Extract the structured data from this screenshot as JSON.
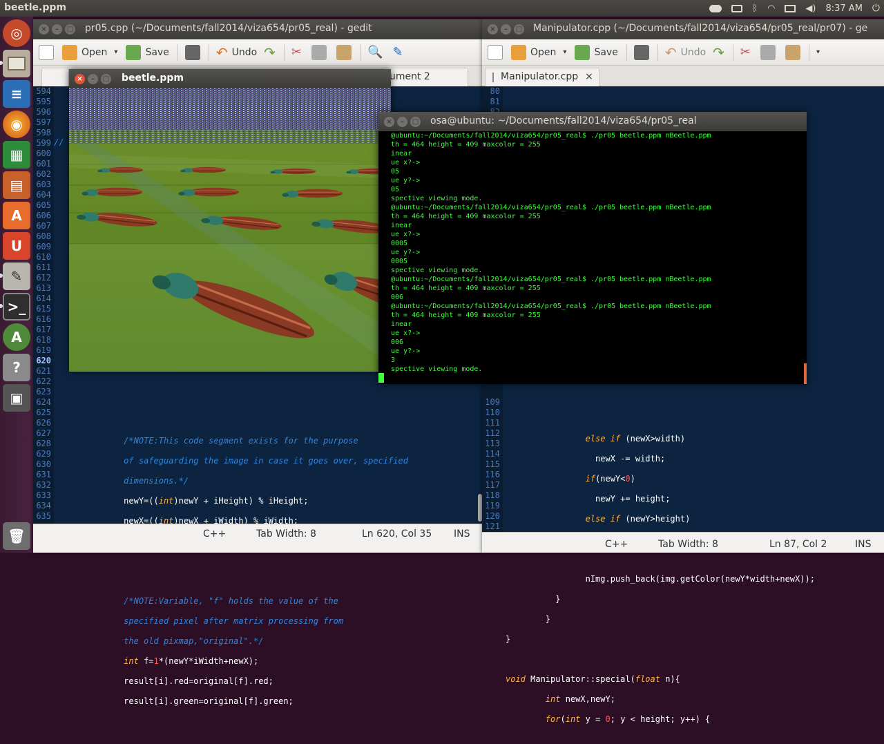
{
  "top_panel": {
    "active_title": "beetle.ppm",
    "time": "8:37 AM",
    "icons": [
      "cloud-icon",
      "keyboard-icon",
      "bluetooth-icon",
      "wifi-icon",
      "mail-icon",
      "volume-icon",
      "power-icon"
    ]
  },
  "launcher": {
    "items": [
      "ubuntu-dash-icon",
      "files-icon",
      "writer-icon",
      "firefox-icon",
      "calc-icon",
      "impress-icon",
      "software-center-icon",
      "ubuntu-one-icon",
      "text-editor-icon",
      "terminal-icon",
      "update-manager-icon",
      "help-icon",
      "save-icon",
      "trash-icon"
    ]
  },
  "gedit_left": {
    "title": "pr05.cpp (~/Documents/fall2014/viza654/pr05_real) - gedit",
    "toolbar": {
      "open": "Open",
      "save": "Save",
      "undo": "Undo"
    },
    "tab_partial": "ument 2",
    "line_numbers": [
      "594",
      "595",
      "596",
      "597",
      "598",
      "599",
      "600",
      "601",
      "602",
      "603",
      "604",
      "605",
      "606",
      "607",
      "608",
      "609",
      "610",
      "611",
      "612",
      "613",
      "614",
      "615",
      "616",
      "617",
      "618",
      "619",
      "620",
      "621",
      "622",
      "623",
      "624",
      "625",
      "626",
      "627",
      "628",
      "629",
      "630",
      "631",
      "632",
      "633",
      "634",
      "635"
    ],
    "status": {
      "language": "C++",
      "tab_width": "Tab Width:  8",
      "position": "Ln 620, Col 35",
      "mode": "INS"
    }
  },
  "gedit_right": {
    "title": "Manipulator.cpp (~/Documents/fall2014/viza654/pr05_real/pr07) - ge",
    "toolbar": {
      "open": "Open",
      "save": "Save",
      "undo": "Undo"
    },
    "tab": "Manipulator.cpp",
    "line_numbers_top": [
      "80",
      "81",
      "82"
    ],
    "line_numbers_bottom": [
      "109",
      "110",
      "111",
      "112",
      "113",
      "114",
      "115",
      "116",
      "117",
      "118",
      "119",
      "120",
      "121",
      "122",
      "123"
    ],
    "status": {
      "language": "C++",
      "tab_width": "Tab Width:  8",
      "position": "Ln 87, Col 2",
      "mode": "INS"
    }
  },
  "beetle_window": {
    "title": "beetle.ppm"
  },
  "terminal": {
    "title": "osa@ubuntu: ~/Documents/fall2014/viza654/pr05_real",
    "lines": [
      "@ubuntu:~/Documents/fall2014/viza654/pr05_real$ ./pr05 beetle.ppm nBeetle.ppm",
      "th = 464 height = 409 maxcolor = 255",
      "inear",
      "ue x?->",
      "05",
      "ue y?->",
      "05",
      "spective viewing mode.",
      "@ubuntu:~/Documents/fall2014/viza654/pr05_real$ ./pr05 beetle.ppm nBeetle.ppm",
      "th = 464 height = 409 maxcolor = 255",
      "inear",
      "ue x?->",
      "0005",
      "ue y?->",
      "0005",
      "spective viewing mode.",
      "@ubuntu:~/Documents/fall2014/viza654/pr05_real$ ./pr05 beetle.ppm nBeetle.ppm",
      "th = 464 height = 409 maxcolor = 255",
      "006",
      "@ubuntu:~/Documents/fall2014/viza654/pr05_real$ ./pr05 beetle.ppm nBeetle.ppm",
      "th = 464 height = 409 maxcolor = 255",
      "inear",
      "ue x?->",
      "006",
      "ue y?->",
      "3",
      "spective viewing mode."
    ]
  }
}
